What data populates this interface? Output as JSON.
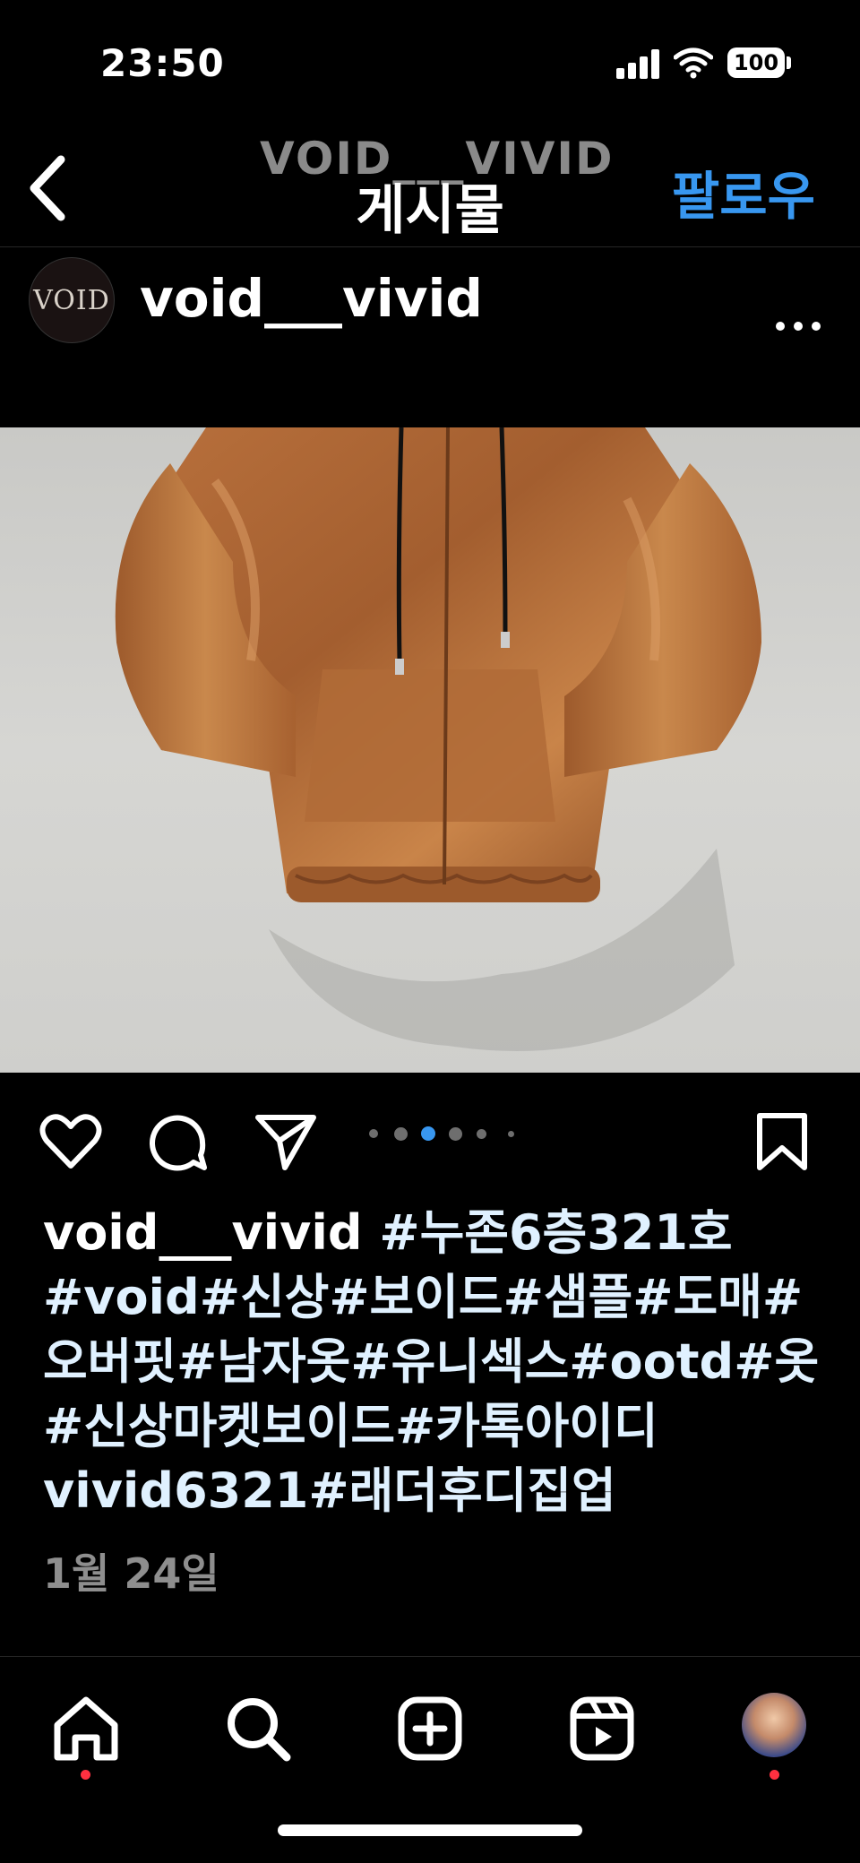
{
  "status_bar": {
    "time": "23:50",
    "battery": "100"
  },
  "header": {
    "back_icon": "chevron-left-icon",
    "brand_overlay": "VOID___VIVID",
    "title": "게시물",
    "follow_label": "팔로우",
    "accent_color": "#3897f0"
  },
  "post": {
    "avatar_text": "VOID",
    "username": "void___vivid",
    "more_icon": "more-horizontal-icon",
    "image_alt_icon": "leather-hoodie-jacket",
    "carousel": {
      "total": 6,
      "active_index": 2
    }
  },
  "actions": {
    "like_icon": "heart-icon",
    "comment_icon": "comment-icon",
    "share_icon": "send-icon",
    "save_icon": "bookmark-icon"
  },
  "caption": {
    "username": "void___vivid",
    "text": " #누존6층321호 #void#신상#보이드#샘플#도매#오버핏#남자옷#유니섹스#ootd#옷#신상마켓보이드#카톡아이디 vivid6321#래더후디집업"
  },
  "date": "1월 24일",
  "bottom_nav": {
    "home_icon": "home-icon",
    "search_icon": "search-icon",
    "create_icon": "plus-square-icon",
    "reels_icon": "reels-icon",
    "profile_icon": "profile-avatar"
  }
}
